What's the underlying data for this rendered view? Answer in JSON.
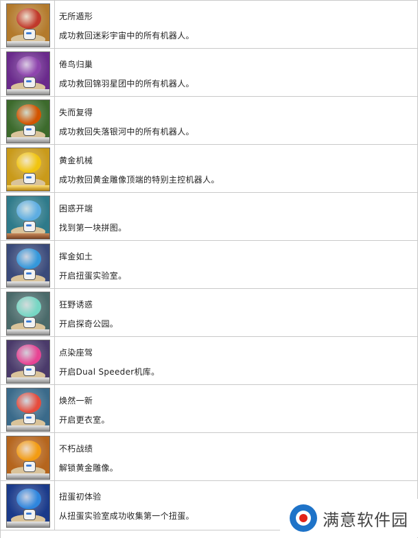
{
  "trophies": [
    {
      "name": "无所遁形",
      "desc": "成功救回迷彩宇宙中的所有机器人。",
      "rank": "silver",
      "icon": "galaxy-swirl-icon",
      "sky": "#b37a2c",
      "emblem": "#c0392b"
    },
    {
      "name": "倦鸟归巢",
      "desc": "成功救回锦羽星团中的所有机器人。",
      "rank": "silver",
      "icon": "galaxy-swirl-icon",
      "sky": "#6a2a8c",
      "emblem": "#8e44ad"
    },
    {
      "name": "失而复得",
      "desc": "成功救回失落银河中的所有机器人。",
      "rank": "silver",
      "icon": "galaxy-swirl-icon",
      "sky": "#3c6a2c",
      "emblem": "#d35400"
    },
    {
      "name": "黄金机械",
      "desc": "成功救回黄金雕像顶端的特别主控机器人。",
      "rank": "gold",
      "icon": "gold-statue-icon",
      "sky": "#c99a1a",
      "emblem": "#f1c40f"
    },
    {
      "name": "困惑开端",
      "desc": "找到第一块拼图。",
      "rank": "bronze",
      "icon": "puzzle-piece-icon",
      "sky": "#2e7a8a",
      "emblem": "#5dade2"
    },
    {
      "name": "挥金如土",
      "desc": "开启扭蛋实验室。",
      "rank": "silver",
      "icon": "gacha-lab-icon",
      "sky": "#3a4a7a",
      "emblem": "#3498db"
    },
    {
      "name": "狂野诱惑",
      "desc": "开启探奇公园。",
      "rank": "silver",
      "icon": "elephant-park-icon",
      "sky": "#4a6a6a",
      "emblem": "#76d7c4"
    },
    {
      "name": "点染座驾",
      "desc": "开启Dual Speeder机库。",
      "rank": "silver",
      "icon": "speeder-garage-icon",
      "sky": "#4a3a6a",
      "emblem": "#e84393"
    },
    {
      "name": "焕然一新",
      "desc": "开启更衣室。",
      "rank": "silver",
      "icon": "dressing-room-icon",
      "sky": "#3a6a8a",
      "emblem": "#e74c3c"
    },
    {
      "name": "不朽战绩",
      "desc": "解锁黄金雕像。",
      "rank": "silver",
      "icon": "gold-robot-icon",
      "sky": "#b5651d",
      "emblem": "#f39c12"
    },
    {
      "name": "扭蛋初体验",
      "desc": "从扭蛋实验室成功收集第一个扭蛋。",
      "rank": "silver",
      "icon": "playstation-capsule-icon",
      "sky": "#1a3a8a",
      "emblem": "#2e86de"
    }
  ],
  "watermark": {
    "text": "满意软件园"
  }
}
